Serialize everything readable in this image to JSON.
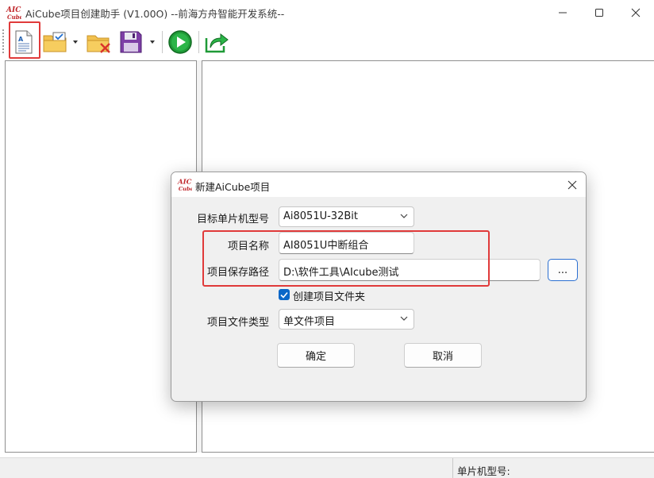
{
  "window": {
    "title": "AiCube项目创建助手 (V1.00O) --前海方舟智能开发系统--",
    "logo_text_top": "AIC",
    "logo_text_bottom": "Cube"
  },
  "toolbar": {
    "items": [
      {
        "icon": "new-project-icon"
      },
      {
        "icon": "open-project-icon"
      },
      {
        "icon": "close-project-icon"
      },
      {
        "icon": "save-project-icon"
      },
      {
        "icon": "run-icon"
      },
      {
        "icon": "export-icon"
      }
    ]
  },
  "status_bar": {
    "chip_model_label": "单片机型号:"
  },
  "dialog": {
    "title": "新建AiCube项目",
    "target_mcu_label": "目标单片机型号",
    "target_mcu_value": "Ai8051U-32Bit",
    "project_name_label": "项目名称",
    "project_name_value": "AI8051U中断组合",
    "save_path_label": "项目保存路径",
    "save_path_value": "D:\\软件工具\\AIcube测试",
    "browse_label": "...",
    "create_folder_label": "创建项目文件夹",
    "create_folder_checked": true,
    "file_type_label": "项目文件类型",
    "file_type_value": "单文件项目",
    "ok_label": "确定",
    "cancel_label": "取消"
  },
  "colors": {
    "highlight": "#e03a3a",
    "accent": "#0a67c8",
    "run_green": "#1f9a37"
  }
}
